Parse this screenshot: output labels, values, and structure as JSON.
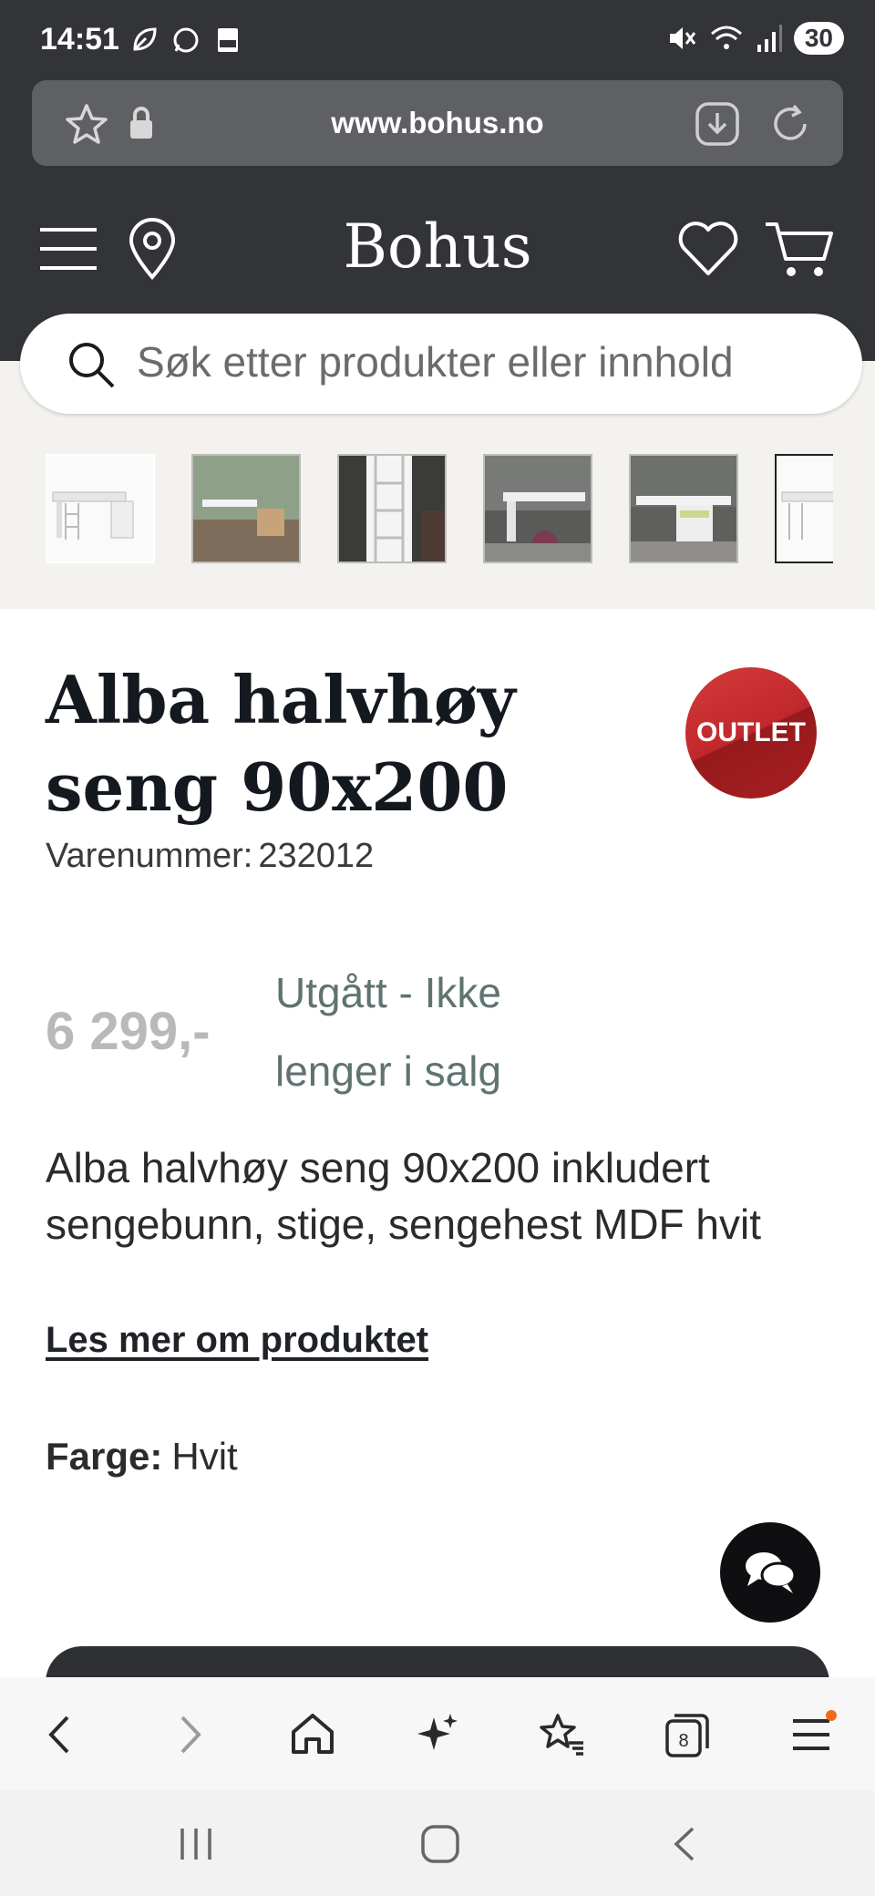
{
  "status_bar": {
    "time": "14:51",
    "battery": "30",
    "left_icons": [
      "leaf-icon",
      "whatsapp-icon",
      "pdf-icon"
    ],
    "right_icons": [
      "mute-icon",
      "wifi-icon",
      "signal-icon"
    ]
  },
  "browser": {
    "url": "www.bohus.no"
  },
  "header": {
    "logo": "Bohus",
    "search_placeholder": "Søk etter produkter eller innhold"
  },
  "gallery": {
    "thumbnails": [
      {
        "alt": "white bed"
      },
      {
        "alt": "bed in green room"
      },
      {
        "alt": "ladder close-up"
      },
      {
        "alt": "children room"
      },
      {
        "alt": "bed with desk"
      },
      {
        "alt": "white bed"
      }
    ]
  },
  "product": {
    "title": "Alba halvhøy seng 90x200",
    "badge": "OUTLET",
    "sku_label": "Varenummer:",
    "sku_value": "232012",
    "price": "6 299,-",
    "availability": "Utgått - Ikke lenger i salg",
    "description": "Alba halvhøy seng 90x200 inkludert sengebunn, stige, sengehest MDF hvit",
    "read_more": "Les mer om produktet",
    "color_label": "Farge:",
    "color_value": "Hvit"
  },
  "bottom_nav": {
    "tabs_count": "8"
  },
  "colors": {
    "header_bg": "#333438",
    "outlet_red": "#c0282c",
    "status_green": "#5f7370",
    "gallery_bg": "#f3f2ef"
  }
}
